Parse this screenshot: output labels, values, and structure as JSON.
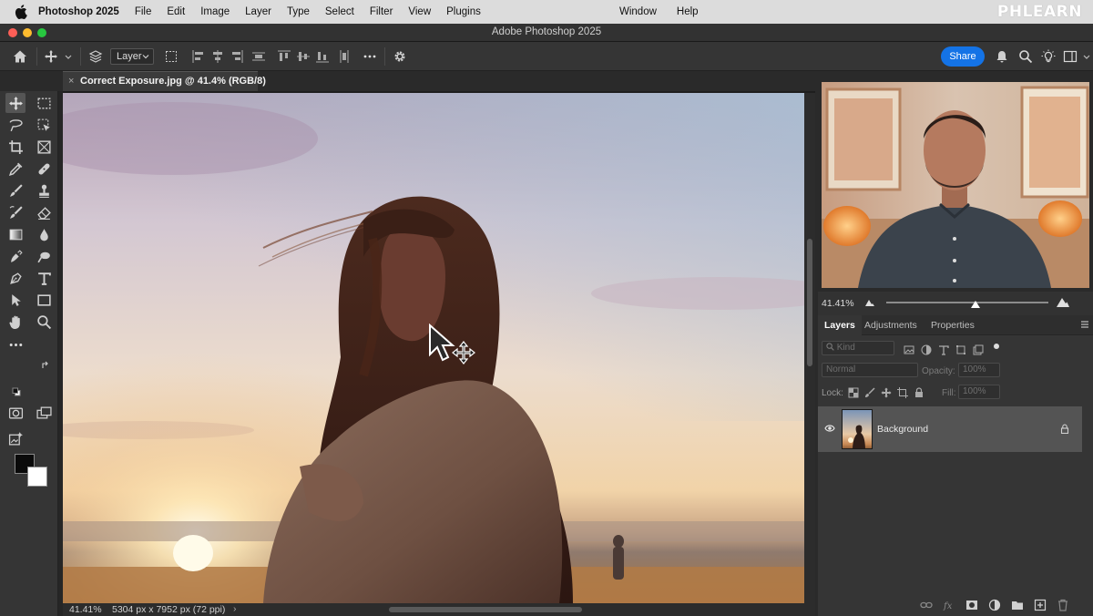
{
  "menubar": {
    "app_name": "Photoshop 2025",
    "items": [
      "File",
      "Edit",
      "Image",
      "Layer",
      "Type",
      "Select",
      "Filter",
      "View",
      "Plugins"
    ],
    "right_items": [
      "Window",
      "Help"
    ],
    "watermark": "PHLEARN"
  },
  "window": {
    "title": "Adobe Photoshop 2025"
  },
  "options_bar": {
    "layer_select_value": "Layer",
    "share_label": "Share"
  },
  "document": {
    "tab_close": "×",
    "tab_title": "Correct Exposure.jpg @ 41.4% (RGB/8)"
  },
  "status_bar": {
    "zoom": "41.41%",
    "dimensions": "5304 px x 7952 px (72 ppi)",
    "arrow": "›"
  },
  "navigator": {
    "zoom": "41.41%",
    "zoom_slider_fraction": 0.55
  },
  "layers_panel": {
    "tabs": [
      "Layers",
      "Adjustments",
      "Properties"
    ],
    "filter_placeholder": "Kind",
    "blend_mode": "Normal",
    "opacity_label": "Opacity:",
    "opacity_value": "100%",
    "lock_label": "Lock:",
    "fill_label": "Fill:",
    "fill_value": "100%",
    "layers": [
      {
        "name": "Background",
        "visible": true,
        "locked": true
      }
    ]
  },
  "colors": {
    "accent_blue": "#1473e6",
    "foreground": "#0a0a0a",
    "background": "#ffffff",
    "panel": "#353535"
  },
  "icons": {
    "toolbar": [
      "move-icon",
      "marquee-icon",
      "lasso-icon",
      "object-select-icon",
      "crop-icon",
      "frame-icon",
      "eyedropper-icon",
      "healing-icon",
      "brush-icon",
      "stamp-icon",
      "history-brush-icon",
      "eraser-icon",
      "gradient-icon",
      "blur-icon",
      "smudge-icon",
      "dodge-icon",
      "pen-icon",
      "type-icon",
      "path-select-icon",
      "rectangle-icon",
      "hand-icon",
      "zoom-icon",
      "more-tools-icon"
    ]
  }
}
